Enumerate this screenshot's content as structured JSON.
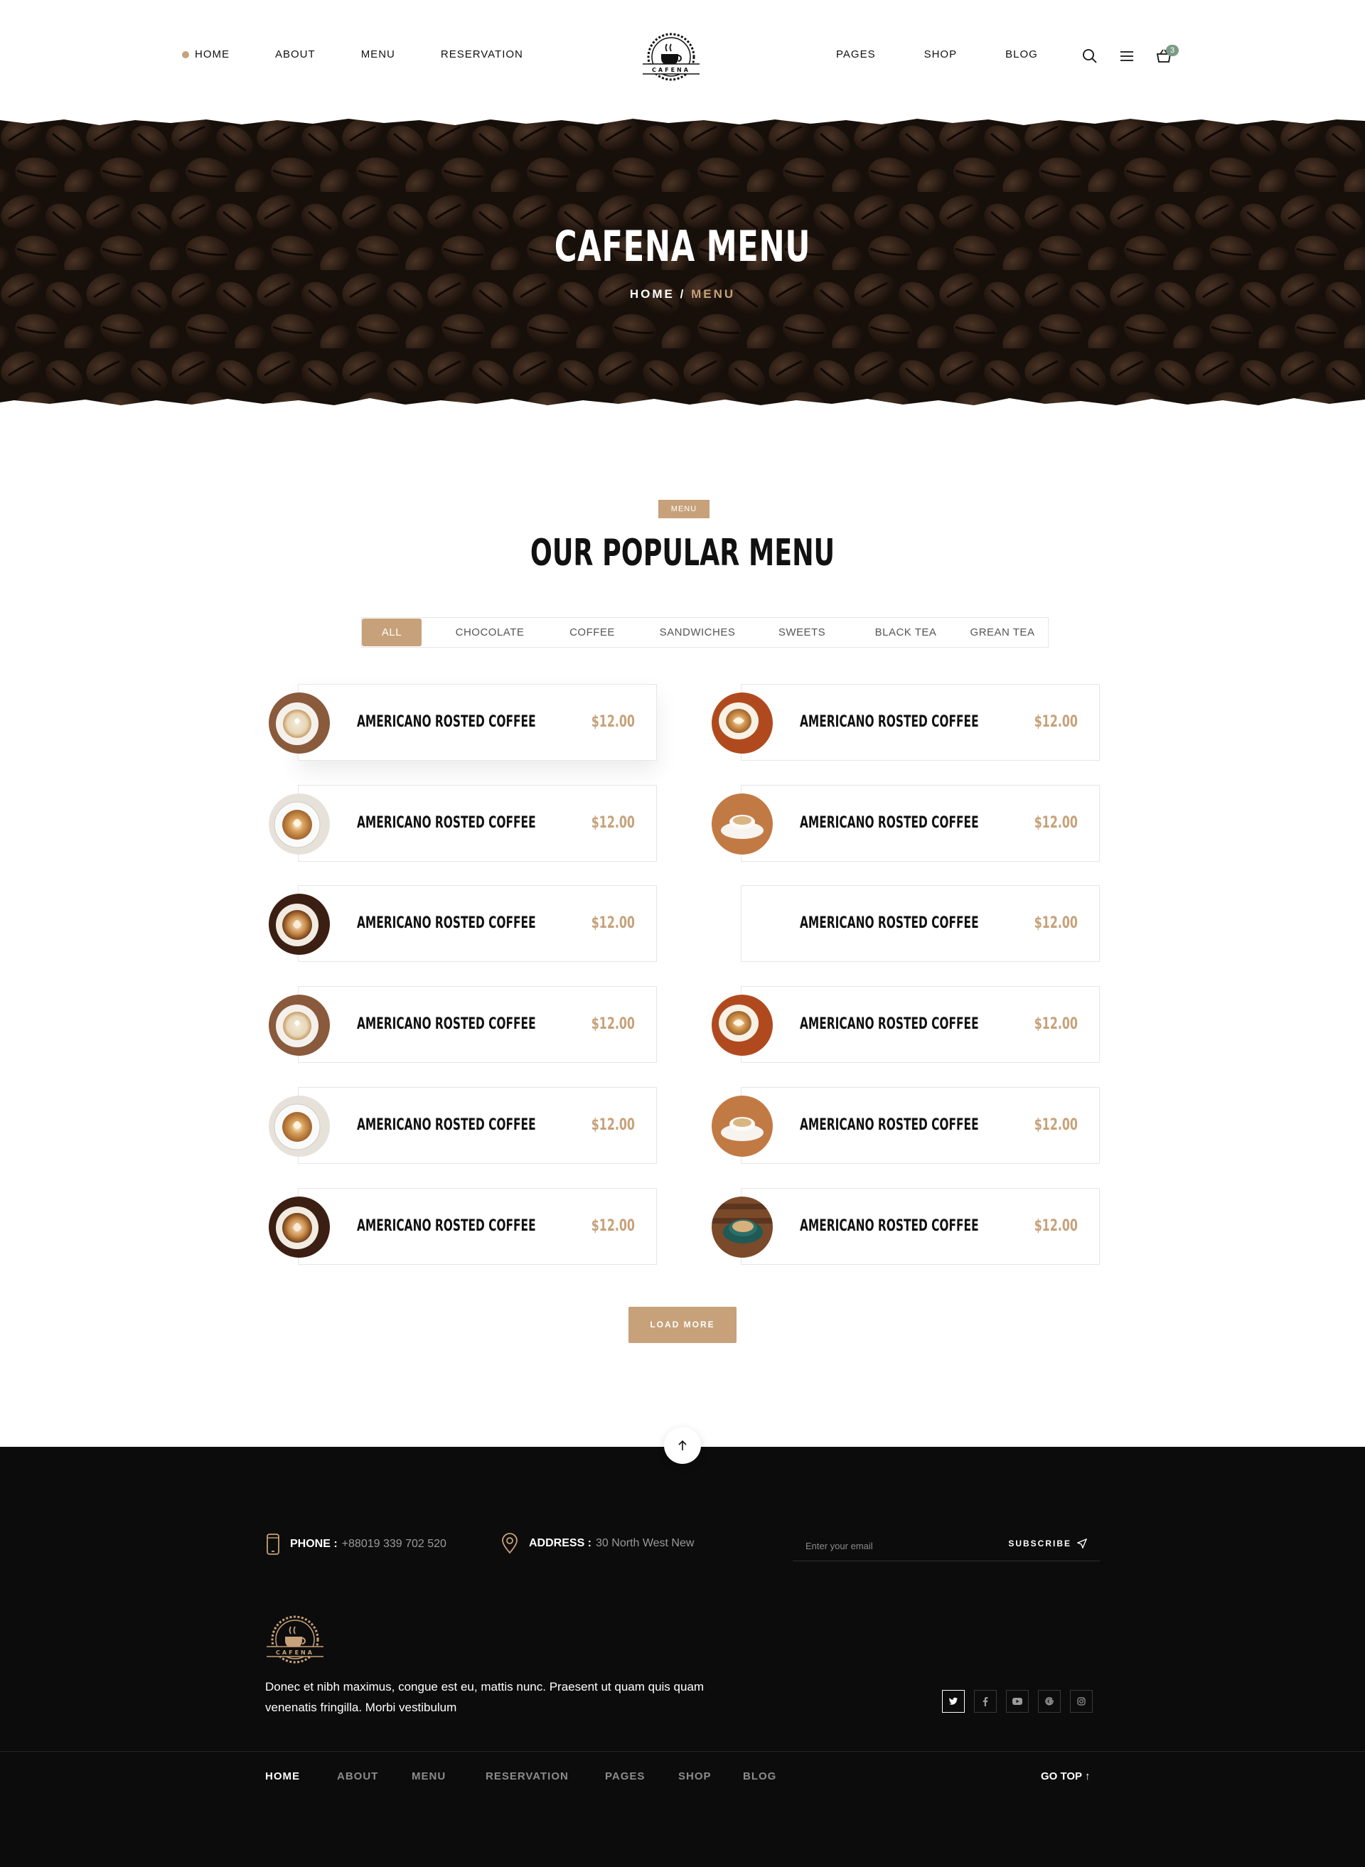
{
  "header": {
    "nav_left": [
      {
        "label": "HOME",
        "active": true
      },
      {
        "label": "ABOUT"
      },
      {
        "label": "MENU"
      },
      {
        "label": "RESERVATION"
      }
    ],
    "nav_right": [
      {
        "label": "PAGES"
      },
      {
        "label": "SHOP"
      },
      {
        "label": "BLOG"
      }
    ],
    "logo_text": "CAFENA",
    "icons": [
      "search-icon",
      "hamburger-menu-icon",
      "basket-icon"
    ],
    "cart_count": "3"
  },
  "hero": {
    "title": "CAFENA MENU",
    "breadcrumb_home": "HOME",
    "breadcrumb_sep": "/",
    "breadcrumb_current": "MENU"
  },
  "menu_section": {
    "tag": "MENU",
    "title": "OUR POPULAR MENU",
    "filters": [
      "ALL",
      "CHOCOLATE",
      "COFFEE",
      "SANDWICHES",
      "SWEETS",
      "BLACK TEA",
      "GREAN TEA"
    ],
    "active_filter": "ALL",
    "items": [
      {
        "name": "AMERICANO ROSTED COFFEE",
        "price": "$12.00"
      },
      {
        "name": "AMERICANO ROSTED COFFEE",
        "price": "$12.00"
      },
      {
        "name": "AMERICANO ROSTED COFFEE",
        "price": "$12.00"
      },
      {
        "name": "AMERICANO ROSTED COFFEE",
        "price": "$12.00"
      },
      {
        "name": "AMERICANO ROSTED COFFEE",
        "price": "$12.00"
      },
      {
        "name": "AMERICANO ROSTED COFFEE",
        "price": "$12.00"
      },
      {
        "name": "AMERICANO ROSTED COFFEE",
        "price": "$12.00"
      },
      {
        "name": "AMERICANO ROSTED COFFEE",
        "price": "$12.00"
      },
      {
        "name": "AMERICANO ROSTED COFFEE",
        "price": "$12.00"
      },
      {
        "name": "AMERICANO ROSTED COFFEE",
        "price": "$12.00"
      },
      {
        "name": "AMERICANO ROSTED COFFEE",
        "price": "$12.00"
      },
      {
        "name": "AMERICANO ROSTED COFFEE",
        "price": "$12.00"
      }
    ],
    "load_more": "LOAD MORE"
  },
  "footer": {
    "phone_label": "PHONE :",
    "phone_value": "+88019 339 702 520",
    "address_label": "ADDRESS :",
    "address_value": "30 North West New",
    "email_placeholder": "Enter your email",
    "subscribe_label": "SUBSCRIBE",
    "logo_text": "CAFENA",
    "description": "Donec et nibh maximus, congue est eu, mattis nunc. Praesent ut quam quis quam venenatis fringilla. Morbi vestibulum",
    "socials": [
      "twitter-icon",
      "facebook-icon",
      "youtube-icon",
      "google-icon",
      "instagram-icon"
    ],
    "bottom_nav": [
      {
        "label": "HOME",
        "active": true
      },
      {
        "label": "ABOUT"
      },
      {
        "label": "MENU"
      },
      {
        "label": "RESERVATION"
      },
      {
        "label": "PAGES"
      },
      {
        "label": "SHOP"
      },
      {
        "label": "BLOG"
      }
    ],
    "go_top": "GO TOP",
    "go_top_arrow": "↑"
  },
  "colors": {
    "accent": "#c7a17a",
    "footer_bg": "#0c0c0c",
    "badge": "#7d9a86"
  }
}
